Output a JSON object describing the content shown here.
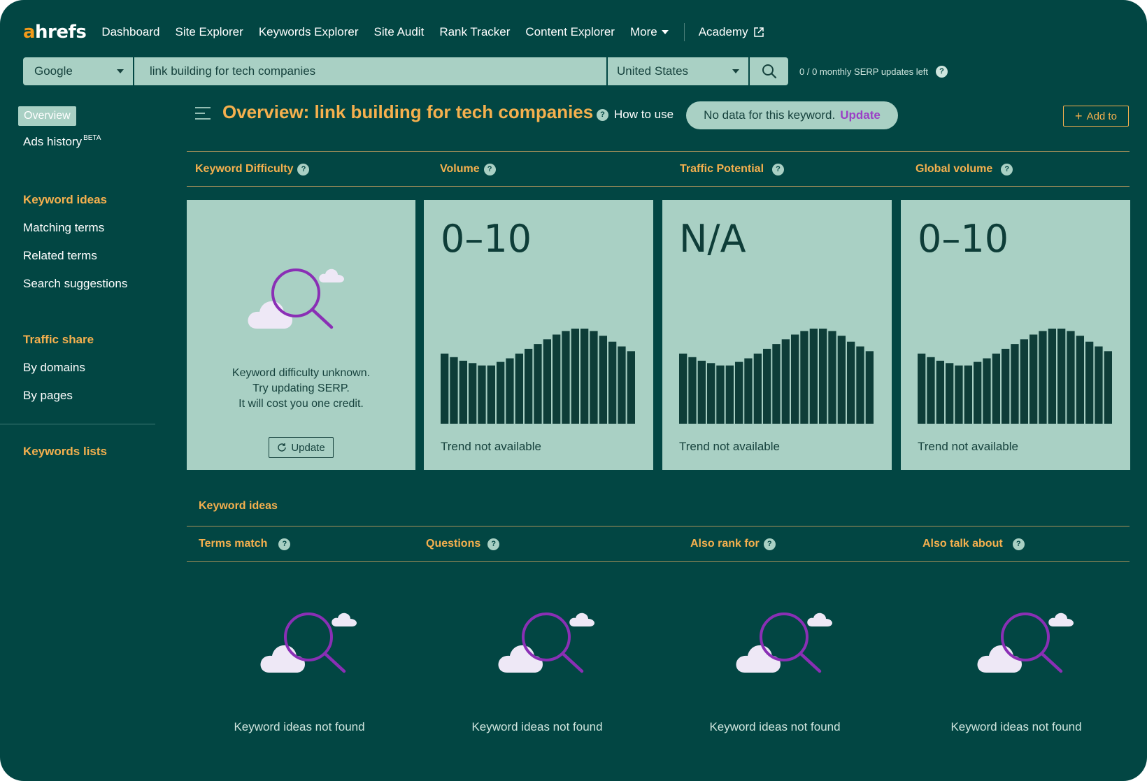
{
  "nav": {
    "logo_a": "a",
    "logo_rest": "hrefs",
    "items": [
      "Dashboard",
      "Site Explorer",
      "Keywords Explorer",
      "Site Audit",
      "Rank Tracker",
      "Content Explorer"
    ],
    "more": "More",
    "academy": "Academy"
  },
  "search": {
    "engine": "Google",
    "keyword": "link building for tech companies",
    "country": "United States",
    "serp_updates": "0 / 0 monthly SERP updates left"
  },
  "sidebar": {
    "overview": "Overview",
    "ads_history": "Ads history",
    "beta": "BETA",
    "keyword_ideas_head": "Keyword ideas",
    "matching_terms": "Matching terms",
    "related_terms": "Related terms",
    "search_suggestions": "Search suggestions",
    "traffic_share_head": "Traffic share",
    "by_domains": "By domains",
    "by_pages": "By pages",
    "keywords_lists": "Keywords lists"
  },
  "header": {
    "title": "Overview: link building for tech companies",
    "how_to_use": "How to use",
    "no_data": "No data for this keyword.",
    "update_link": "Update",
    "add_to": "Add to"
  },
  "metrics": {
    "kd_label": "Keyword Difficulty",
    "volume_label": "Volume",
    "tp_label": "Traffic Potential",
    "gv_label": "Global volume",
    "kd_line1": "Keyword difficulty unknown.",
    "kd_line2": "Try updating SERP.",
    "kd_line3": "It will cost you one credit.",
    "kd_update": "Update",
    "volume_value": "0–10",
    "tp_value": "N/A",
    "gv_value": "0–10",
    "trend_na": "Trend not available",
    "placeholder_bars": [
      0.59,
      0.56,
      0.53,
      0.51,
      0.49,
      0.49,
      0.52,
      0.55,
      0.59,
      0.63,
      0.67,
      0.71,
      0.75,
      0.78,
      0.8,
      0.8,
      0.78,
      0.74,
      0.69,
      0.65,
      0.61
    ]
  },
  "ideas": {
    "title": "Keyword ideas",
    "terms_match": "Terms match",
    "questions": "Questions",
    "also_rank_for": "Also rank for",
    "also_talk_about": "Also talk about",
    "not_found": "Keyword ideas not found"
  },
  "colors": {
    "background": "#024643",
    "card": "#a9d0c4",
    "accent": "#f5b04e",
    "bars": "#0e3d38",
    "magnifier": "#8a2fb5"
  },
  "icons": [
    "chevron-down-icon",
    "external-link-icon",
    "search-icon",
    "help-icon",
    "menu-icon",
    "plus-icon",
    "refresh-icon",
    "magnifier-cloud-illustration"
  ]
}
